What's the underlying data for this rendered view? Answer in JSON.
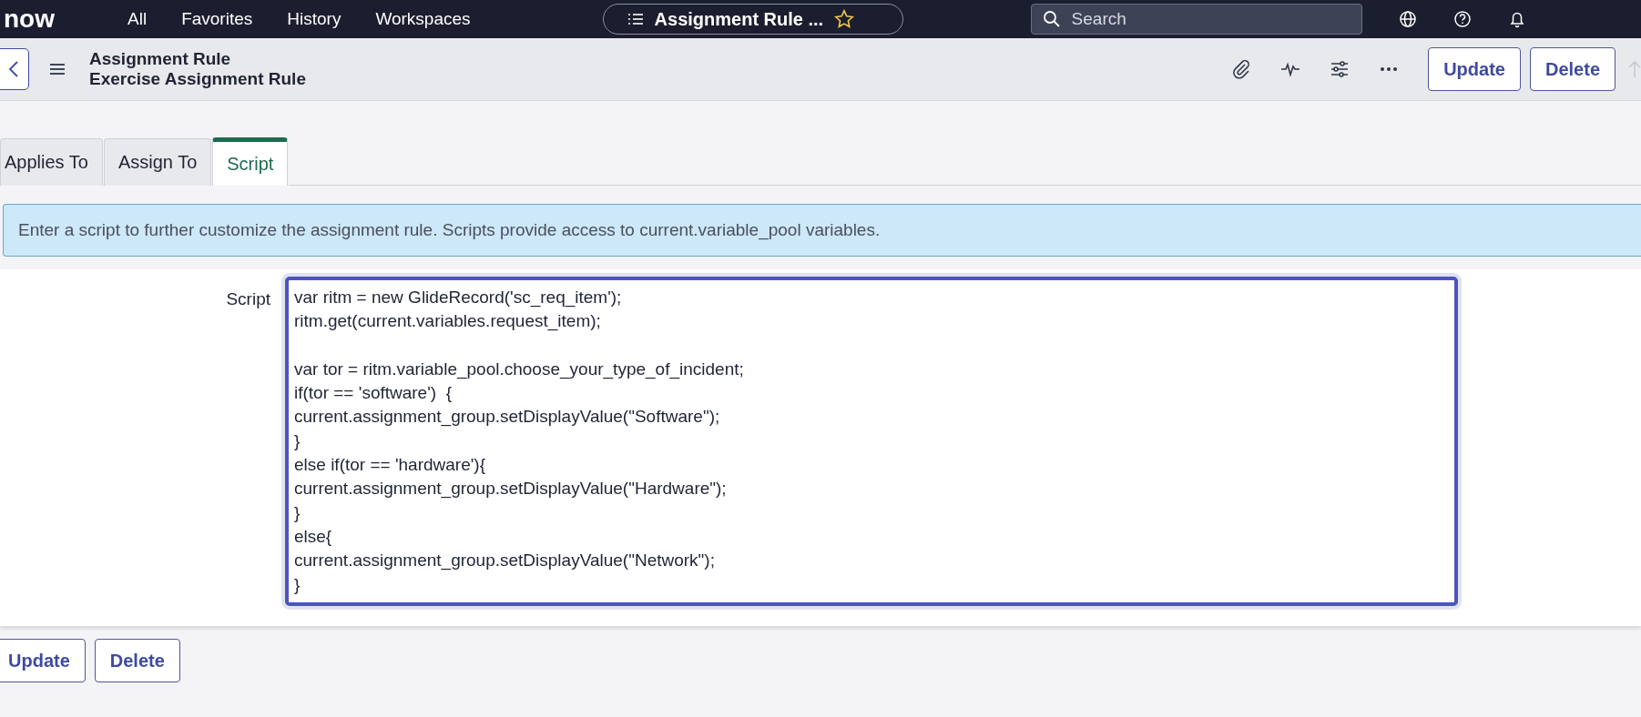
{
  "top_bar": {
    "logo": "now",
    "nav": [
      "All",
      "Favorites",
      "History",
      "Workspaces"
    ],
    "context_pill": "Assignment Rule ...",
    "search": {
      "placeholder": "Search"
    }
  },
  "header": {
    "record_type": "Assignment Rule",
    "record_name": "Exercise Assignment Rule",
    "buttons": [
      "Update",
      "Delete"
    ]
  },
  "tabs": [
    {
      "label": "Applies To",
      "selected": false
    },
    {
      "label": "Assign To",
      "selected": false
    },
    {
      "label": "Script",
      "selected": true
    }
  ],
  "info_message": "Enter a script to further customize the assignment rule. Scripts provide access to current.variable_pool variables.",
  "script_field": {
    "label": "Script",
    "value": "var ritm = new GlideRecord('sc_req_item');\nritm.get(current.variables.request_item);\n\nvar tor = ritm.variable_pool.choose_your_type_of_incident;\nif(tor == 'software')  {\ncurrent.assignment_group.setDisplayValue(\"Software\");\n}\nelse if(tor == 'hardware'){\ncurrent.assignment_group.setDisplayValue(\"Hardware\");\n}\nelse{\ncurrent.assignment_group.setDisplayValue(\"Network\");\n}"
  },
  "footer_buttons": [
    "Update",
    "Delete"
  ]
}
